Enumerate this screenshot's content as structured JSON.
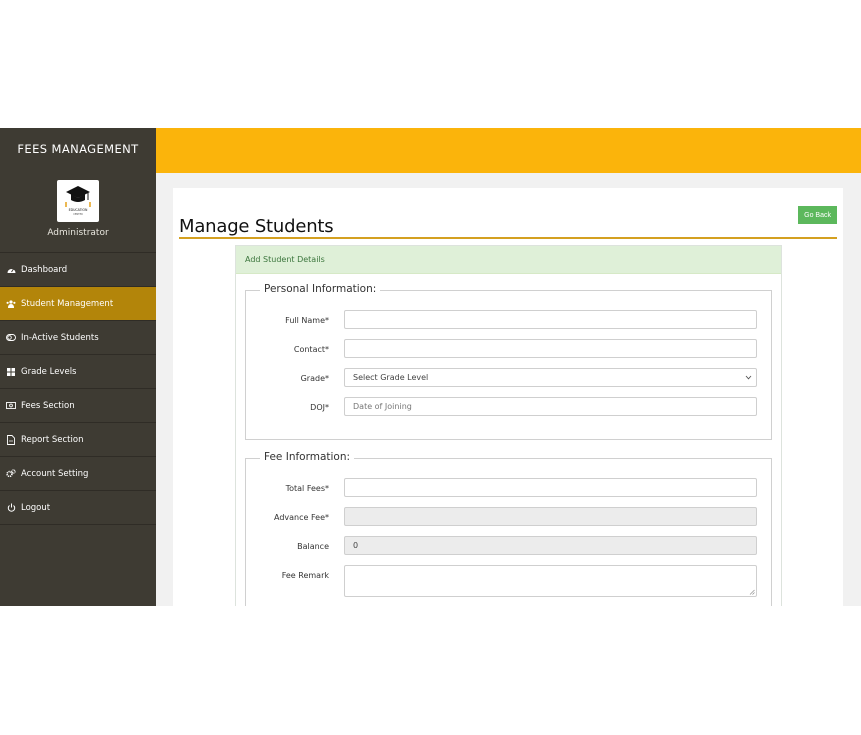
{
  "sidebar": {
    "brand": "FEES MANAGEMENT",
    "logo_text_1": "EDUCATION",
    "logo_text_2": "CENTER",
    "role": "Administrator",
    "items": [
      {
        "label": "Dashboard",
        "icon": "tachometer-icon"
      },
      {
        "label": "Student Management",
        "icon": "users-icon",
        "active": true
      },
      {
        "label": "In-Active Students",
        "icon": "toggle-off-icon"
      },
      {
        "label": "Grade Levels",
        "icon": "grid-icon"
      },
      {
        "label": "Fees Section",
        "icon": "money-icon"
      },
      {
        "label": "Report Section",
        "icon": "file-icon"
      },
      {
        "label": "Account Setting",
        "icon": "cogs-icon"
      },
      {
        "label": "Logout",
        "icon": "power-icon"
      }
    ]
  },
  "colors": {
    "topbar": "#fbb40b",
    "sidebar": "#3e3b33",
    "active": "#b3850a",
    "go_back": "#5cb85c",
    "panel_head": "#dff0d8"
  },
  "main": {
    "title": "Manage Students",
    "go_back": "Go Back",
    "panel_title": "Add Student Details",
    "personal": {
      "legend": "Personal Information:",
      "full_name_label": "Full Name*",
      "full_name_value": "",
      "contact_label": "Contact*",
      "contact_value": "",
      "grade_label": "Grade*",
      "grade_value": "Select Grade Level",
      "doj_label": "DOJ*",
      "doj_placeholder": "Date of Joining"
    },
    "fee": {
      "legend": "Fee Information:",
      "total_label": "Total Fees*",
      "total_value": "",
      "advance_label": "Advance Fee*",
      "advance_value": "",
      "balance_label": "Balance",
      "balance_value": "0",
      "remark_label": "Fee Remark",
      "remark_value": ""
    }
  }
}
